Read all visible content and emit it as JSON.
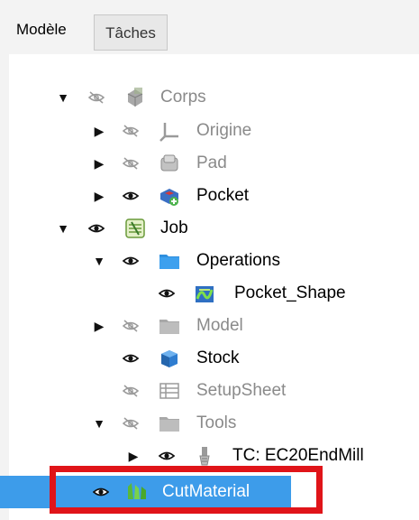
{
  "tabs": [
    {
      "label": "Modèle",
      "active": true
    },
    {
      "label": "Tâches",
      "active": false
    }
  ],
  "tree": [
    {
      "label": "Corps",
      "icon": "body-icon",
      "visible": false,
      "dim": true,
      "arrow": "expanded",
      "level": 0
    },
    {
      "label": "Origine",
      "icon": "origin-icon",
      "visible": false,
      "dim": true,
      "arrow": "collapsed",
      "level": 1
    },
    {
      "label": "Pad",
      "icon": "pad-icon",
      "visible": false,
      "dim": true,
      "arrow": "collapsed",
      "level": 1
    },
    {
      "label": "Pocket",
      "icon": "pocket-icon",
      "visible": true,
      "dim": false,
      "arrow": "collapsed",
      "level": 1
    },
    {
      "label": "Job",
      "icon": "job-icon",
      "visible": true,
      "dim": false,
      "arrow": "expanded",
      "level": 0
    },
    {
      "label": "Operations",
      "icon": "folder-icon",
      "visible": true,
      "dim": false,
      "arrow": "expanded",
      "level": 1
    },
    {
      "label": "Pocket_Shape",
      "icon": "pocket-shape-icon",
      "visible": true,
      "dim": false,
      "arrow": "none",
      "level": 2
    },
    {
      "label": "Model",
      "icon": "folder-icon",
      "visible": false,
      "dim": true,
      "arrow": "collapsed",
      "level": 1
    },
    {
      "label": "Stock",
      "icon": "stock-icon",
      "visible": true,
      "dim": false,
      "arrow": "none",
      "level": 1
    },
    {
      "label": "SetupSheet",
      "icon": "spreadsheet-icon",
      "visible": false,
      "dim": true,
      "arrow": "none",
      "level": 1
    },
    {
      "label": "Tools",
      "icon": "folder-icon",
      "visible": false,
      "dim": true,
      "arrow": "expanded",
      "level": 1
    },
    {
      "label": "TC: EC20EndMill",
      "icon": "tool-controller-icon",
      "visible": true,
      "dim": false,
      "arrow": "collapsed",
      "level": 2
    },
    {
      "label": "CutMaterial",
      "icon": "cut-material-icon",
      "visible": true,
      "dim": false,
      "arrow": "none",
      "level": 0,
      "selected": true
    }
  ],
  "colors": {
    "selection": "#3d9cea",
    "highlight_box": "#e01419",
    "folder": "#2f8fde"
  }
}
